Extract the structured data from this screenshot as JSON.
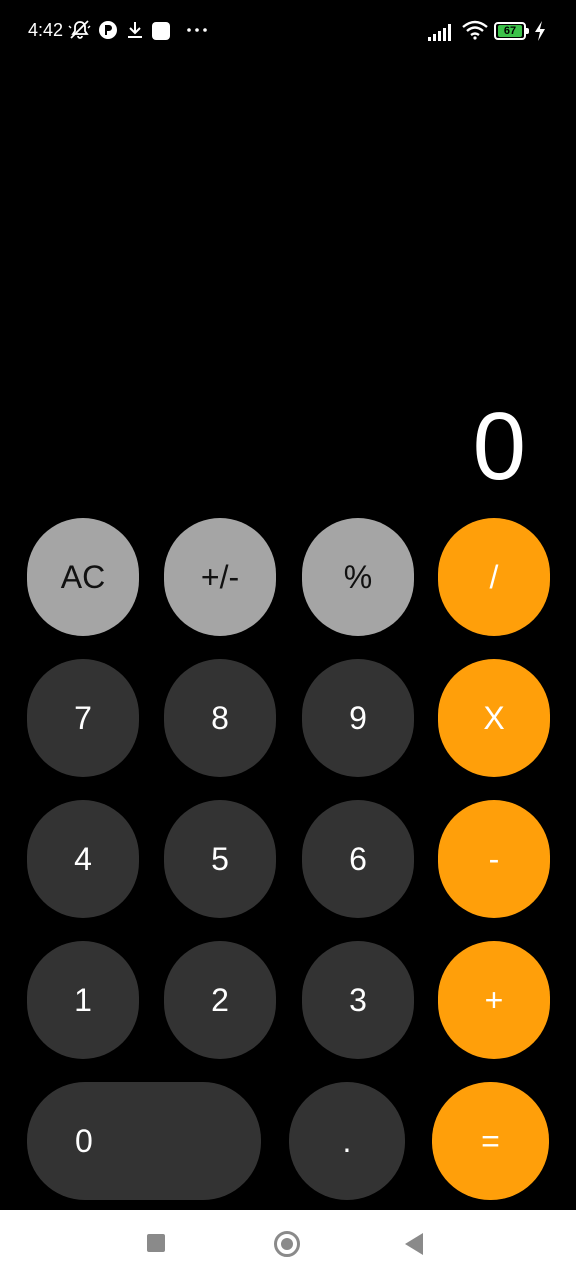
{
  "status_bar": {
    "time": "4:42",
    "battery_level": "67",
    "icons": [
      "mute-icon",
      "app-notification-icon",
      "download-icon",
      "square-notification-icon",
      "more-icon",
      "signal-icon",
      "wifi-icon",
      "battery-icon",
      "charging-icon"
    ]
  },
  "display": {
    "value": "0"
  },
  "keypad": {
    "row1": [
      "AC",
      "+/-",
      "%",
      "/"
    ],
    "row2": [
      "7",
      "8",
      "9",
      "X"
    ],
    "row3": [
      "4",
      "5",
      "6",
      "-"
    ],
    "row4": [
      "1",
      "2",
      "3",
      "+"
    ],
    "row5": [
      "0",
      ".",
      "="
    ]
  },
  "colors": {
    "function_key": "#a5a5a5",
    "number_key": "#333333",
    "operator_key": "#ff9f0a",
    "background": "#000000"
  },
  "nav_bar": {
    "icons": [
      "recent-apps-icon",
      "home-icon",
      "back-icon"
    ]
  }
}
